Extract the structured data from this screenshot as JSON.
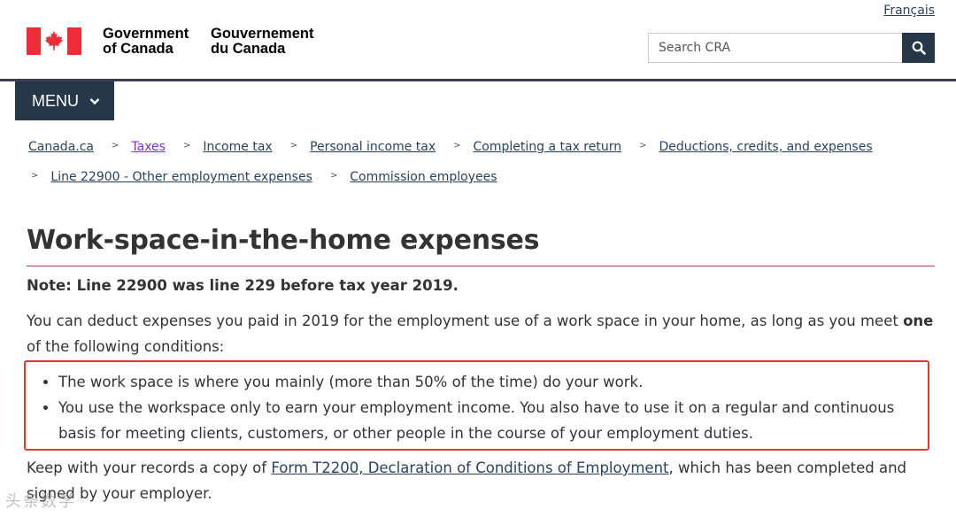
{
  "header": {
    "language_link": "Français",
    "wordmark_en_line1": "Government",
    "wordmark_en_line2": "of Canada",
    "wordmark_fr_line1": "Gouvernement",
    "wordmark_fr_line2": "du Canada",
    "search_placeholder": "Search CRA",
    "search_icon": "search-icon",
    "flag_red": "#eb2d37"
  },
  "menu": {
    "label": "MENU",
    "icon": "chevron-down-icon"
  },
  "breadcrumbs": [
    {
      "label": "Canada.ca",
      "visited": false
    },
    {
      "label": "Taxes",
      "visited": true
    },
    {
      "label": "Income tax",
      "visited": false
    },
    {
      "label": "Personal income tax",
      "visited": false
    },
    {
      "label": "Completing a tax return",
      "visited": false
    },
    {
      "label": "Deductions, credits, and expenses",
      "visited": false
    },
    {
      "label": "Line 22900 - Other employment expenses",
      "visited": false
    },
    {
      "label": "Commission employees",
      "visited": false
    }
  ],
  "breadcrumb_separator": ">",
  "main": {
    "title": "Work-space-in-the-home expenses",
    "note": "Note: Line 22900 was line 229 before tax year 2019.",
    "intro_text": "You can deduct expenses you paid in 2019 for the employment use of a work space in your home, as long as you meet",
    "intro_emphasis": "one",
    "intro_tail": "of the following conditions:",
    "conditions": [
      "The work space is where you mainly (more than 50% of the time) do your work.",
      "You use the workspace only to earn your employment income. You also have to use it on a regular and continuous basis for meeting clients, customers, or other people in the course of your employment duties."
    ],
    "records_text_before": "Keep with your records a copy of",
    "records_link": "Form T2200, Declaration of Conditions of Employment",
    "records_text_after": ", which has been completed and signed by your employer."
  },
  "watermark": "头条数学",
  "colors": {
    "link": "#284162",
    "visited_link": "#7834bc",
    "header_navy": "#26374a",
    "title_rule": "#af3c43",
    "highlight_border": "#e03838"
  }
}
